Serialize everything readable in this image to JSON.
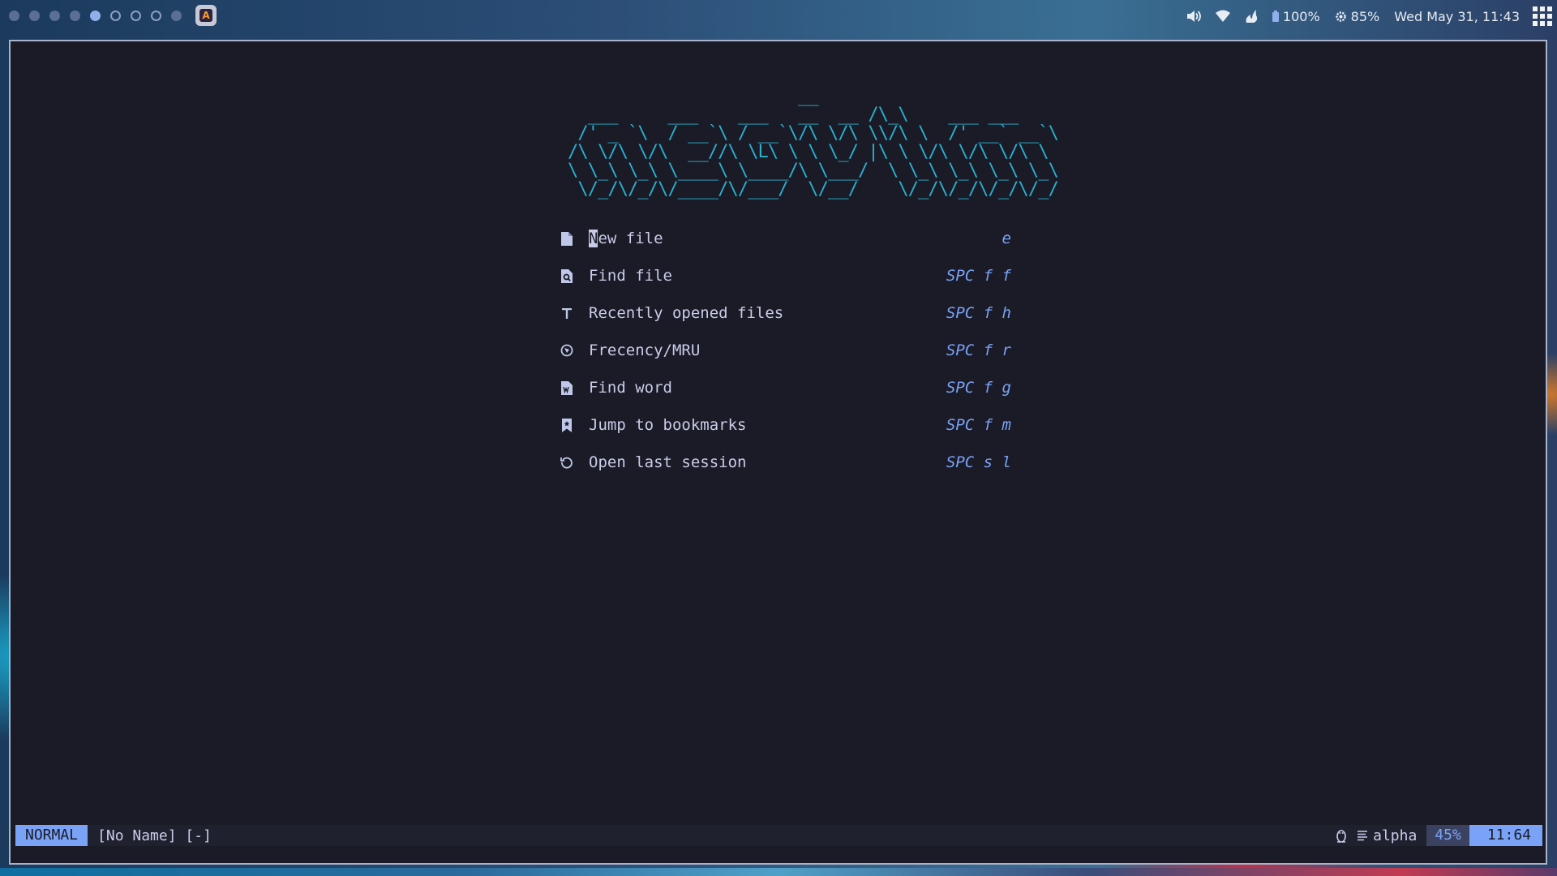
{
  "topbar": {
    "workspaces": [
      "filled",
      "filled",
      "filled",
      "filled",
      "active",
      "empty",
      "empty",
      "empty",
      "filled"
    ],
    "tray": {
      "volume_icon": "speaker-icon",
      "wifi_icon": "wifi-icon",
      "fire_icon": "flame-icon",
      "battery": "100%",
      "brightness": "85%",
      "datetime": "Wed May 31, 11:43"
    },
    "launcher_glyph": "A"
  },
  "dashboard": {
    "ascii_logo": "                       __\n  ___     ___    ___   __  __ /\\_\\    ___ ___\n /' _ `\\  / __`\\ / __`\\/\\ \\/\\ \\\\/\\ \\  /' __` __`\\\n/\\ \\/\\ \\/\\  __//\\ \\L\\ \\ \\ \\_/ |\\ \\ \\/\\ \\/\\ \\/\\ \\\n\\ \\_\\ \\_\\ \\____\\ \\____/\\ \\___/  \\ \\_\\ \\_\\ \\_\\ \\_\\\n \\/_/\\/_/\\/____/\\/___/  \\/__/    \\/_/\\/_/\\/_/\\/_/",
    "buttons": [
      {
        "icon": "file-icon",
        "first": "N",
        "rest": "ew file",
        "key": "e"
      },
      {
        "icon": "file-search-icon",
        "label": "Find file",
        "key": "SPC f f"
      },
      {
        "icon": "text-icon",
        "label": "Recently opened files",
        "key": "SPC f h"
      },
      {
        "icon": "compass-icon",
        "label": "Frecency/MRU",
        "key": "SPC f r"
      },
      {
        "icon": "file-word-icon",
        "label": "Find word",
        "key": "SPC f g"
      },
      {
        "icon": "bookmark-icon",
        "label": "Jump to bookmarks",
        "key": "SPC f m"
      },
      {
        "icon": "history-icon",
        "label": "Open last session",
        "key": "SPC s l"
      }
    ]
  },
  "statusline": {
    "mode": "NORMAL",
    "filename": "[No Name] [-]",
    "os_icon": "linux-tux-icon",
    "filetype_icon": "lines-icon",
    "filetype": "alpha",
    "percent": "45%",
    "position": "11:64"
  },
  "colors": {
    "background": "#1a1b26",
    "accent": "#7aa2f7",
    "logo": "#2ab0d1",
    "text": "#c8cce8"
  }
}
